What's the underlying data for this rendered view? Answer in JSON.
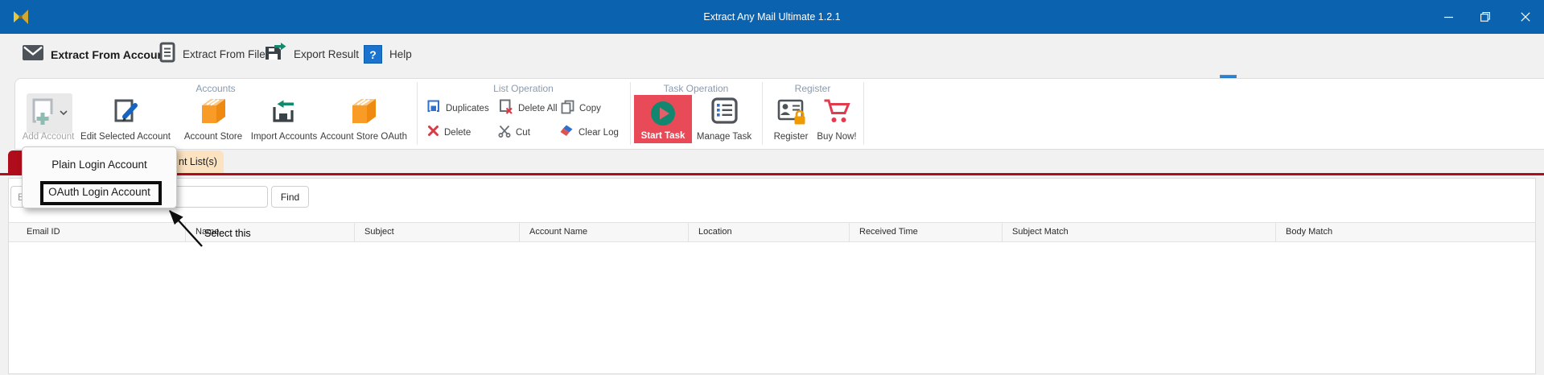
{
  "window": {
    "title": "Extract Any Mail Ultimate 1.2.1"
  },
  "nav_tabs": [
    {
      "label": "Extract From Account"
    },
    {
      "label": "Extract From File"
    },
    {
      "label": "Export Result"
    },
    {
      "label": "Help"
    }
  ],
  "ribbon": {
    "accounts": {
      "title": "Accounts",
      "add_account": "Add Account",
      "edit_selected": "Edit Selected Account",
      "account_store": "Account Store",
      "import_accounts": "Import Accounts",
      "account_store_oauth": "Account Store OAuth"
    },
    "list_operation": {
      "title": "List Operation",
      "duplicates": "Duplicates",
      "delete_all": "Delete All",
      "copy": "Copy",
      "delete": "Delete",
      "cut": "Cut",
      "clear_log": "Clear Log"
    },
    "task_operation": {
      "title": "Task Operation",
      "start_task": "Start Task",
      "manage_task": "Manage Task"
    },
    "register": {
      "title": "Register",
      "register": "Register",
      "buy_now": "Buy Now!"
    }
  },
  "view_tabs": {
    "account_list_partial": "nt List(s)"
  },
  "dropdown": {
    "items": [
      {
        "label": "Plain Login Account"
      },
      {
        "label": "OAuth Login Account"
      }
    ]
  },
  "annotation": {
    "select_this": "Select this"
  },
  "search": {
    "placeholder_visible": "E",
    "find_label": "Find"
  },
  "table": {
    "columns": [
      "Email ID",
      "Name",
      "Subject",
      "Account Name",
      "Location",
      "Received Time",
      "Subject Match",
      "Body Match"
    ]
  },
  "colors": {
    "titlebar_blue": "#0b63b0",
    "active_tab_underline": "#0f6cbd",
    "start_task_red": "#e84b57",
    "task_circle_teal": "#13866f",
    "result_tab_red": "#b00d1c",
    "account_list_tab_tan": "#fbe2c0",
    "help_blue": "#1a73ce",
    "store_orange": "#f89c27",
    "buy_now_red": "#e23b4e",
    "delete_red": "#d93a45",
    "duplicates_blue": "#2f6fd0"
  }
}
